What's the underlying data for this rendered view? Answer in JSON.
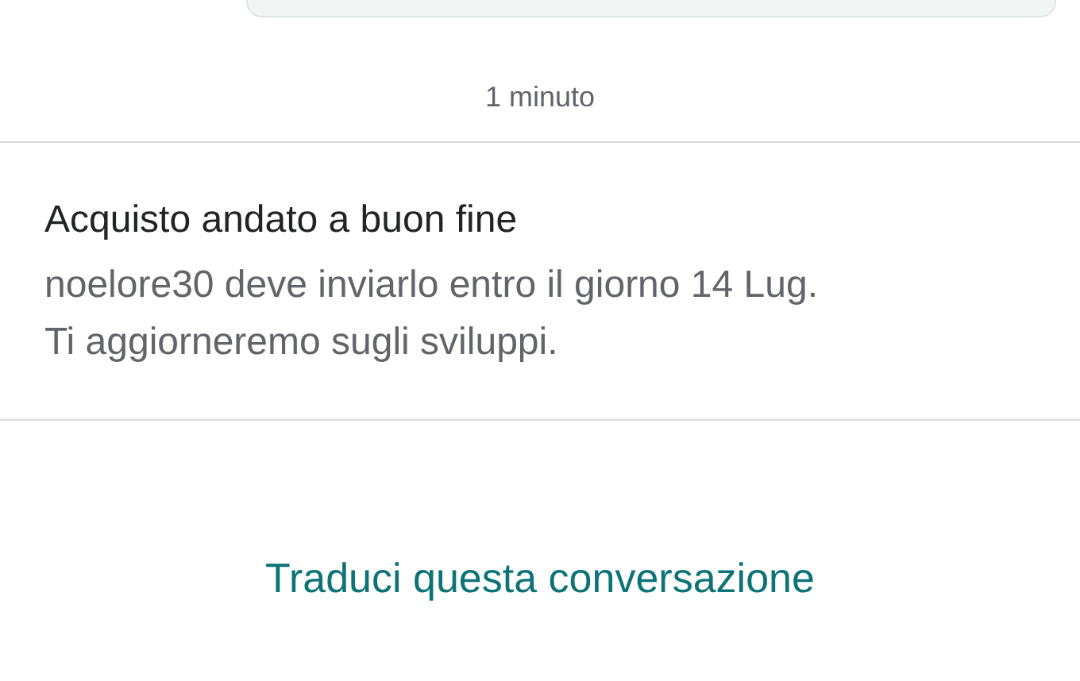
{
  "timestamp": "1 minuto",
  "notice": {
    "title": "Acquisto andato a buon fine",
    "lines": [
      "noelore30 deve inviarlo entro il giorno 14 Lug.",
      "Ti aggiorneremo sugli sviluppi."
    ]
  },
  "translate_link": "Traduci questa conversazione"
}
